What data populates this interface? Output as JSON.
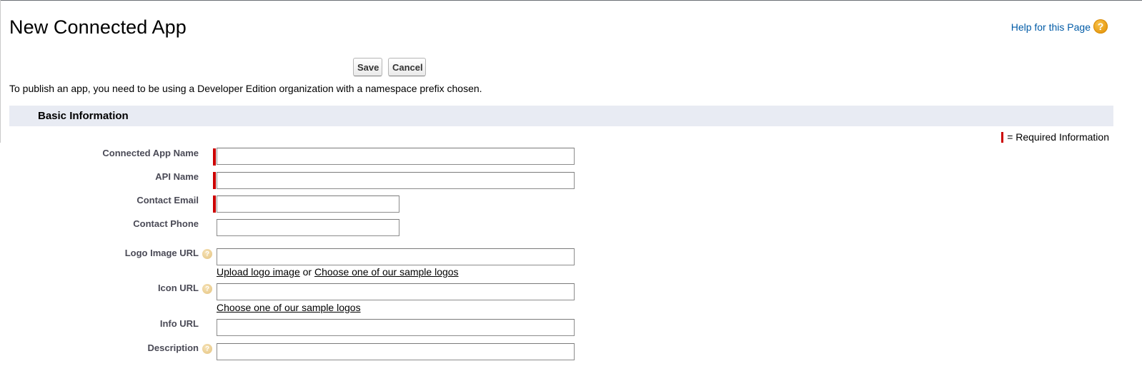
{
  "header": {
    "title": "New Connected App",
    "help_link": "Help for this Page",
    "help_icon": "?"
  },
  "toolbar": {
    "save_label": "Save",
    "cancel_label": "Cancel"
  },
  "note": "To publish an app, you need to be using a Developer Edition organization with a namespace prefix chosen.",
  "section": {
    "title": "Basic Information",
    "required_legend": "= Required Information"
  },
  "fields": {
    "connected_app_name": {
      "label": "Connected App Name",
      "value": ""
    },
    "api_name": {
      "label": "API Name",
      "value": ""
    },
    "contact_email": {
      "label": "Contact Email",
      "value": ""
    },
    "contact_phone": {
      "label": "Contact Phone",
      "value": ""
    },
    "logo_image_url": {
      "label": "Logo Image URL",
      "value": "",
      "upload_link": "Upload logo image",
      "or_text": "or",
      "sample_link": "Choose one of our sample logos"
    },
    "icon_url": {
      "label": "Icon URL",
      "value": "",
      "sample_link": "Choose one of our sample logos"
    },
    "info_url": {
      "label": "Info URL",
      "value": ""
    },
    "description": {
      "label": "Description",
      "value": ""
    }
  },
  "colors": {
    "required": "#cc0000",
    "section_bg": "#e8ebf3",
    "link": "#015ba7"
  }
}
